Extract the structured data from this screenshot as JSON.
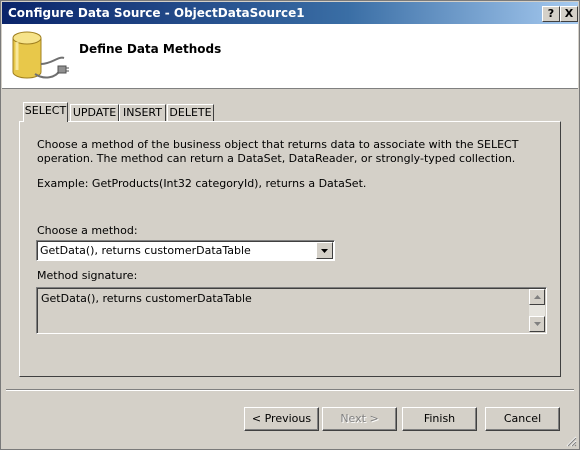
{
  "window": {
    "title": "Configure Data Source - ObjectDataSource1",
    "help_label": "?",
    "close_label": "X"
  },
  "header": {
    "title": "Define Data Methods",
    "icon": "database-plug-icon"
  },
  "tabs": [
    {
      "label": "SELECT",
      "active": true
    },
    {
      "label": "UPDATE",
      "active": false
    },
    {
      "label": "INSERT",
      "active": false
    },
    {
      "label": "DELETE",
      "active": false
    }
  ],
  "panel": {
    "description": "Choose a method of the business object that returns data to associate with the SELECT operation. The method can return a DataSet, DataReader, or strongly-typed collection.",
    "example": "Example: GetProducts(Int32 categoryId), returns a DataSet.",
    "choose_label": "Choose a method:",
    "method_value": "GetData(), returns customerDataTable",
    "signature_label": "Method signature:",
    "signature_value": "GetData(), returns customerDataTable"
  },
  "footer": {
    "previous_label": "< Previous",
    "next_label": "Next >",
    "finish_label": "Finish",
    "cancel_label": "Cancel"
  },
  "colors": {
    "titlebar_start": "#0a246a",
    "titlebar_end": "#a6caf0",
    "face": "#d4d0c8"
  }
}
